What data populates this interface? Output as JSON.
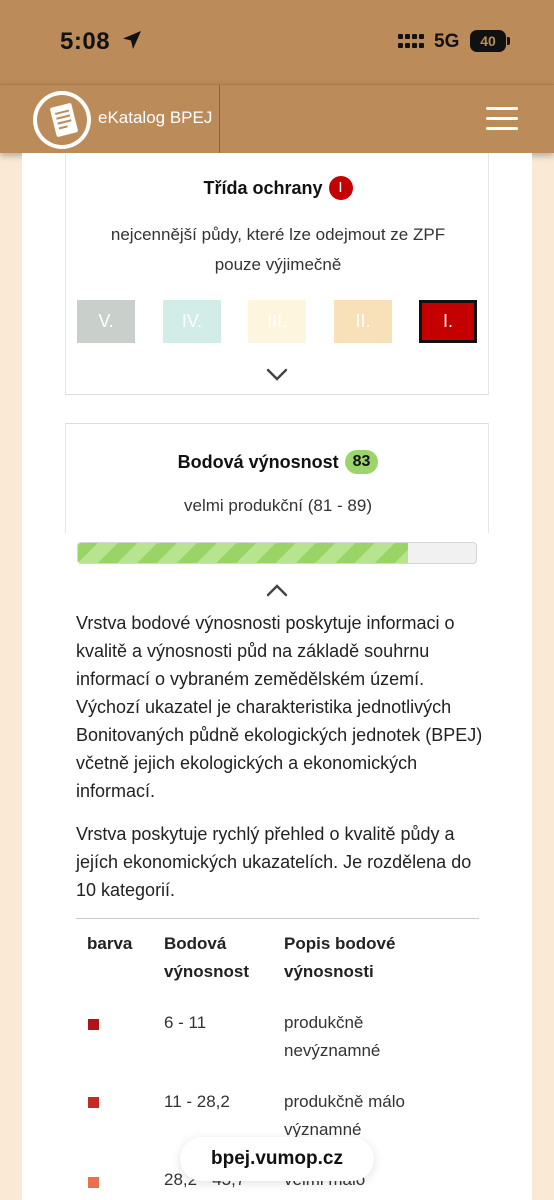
{
  "status_bar": {
    "time": "5:08",
    "network": "5G",
    "battery": "40"
  },
  "header": {
    "app_title": "eKatalog BPEJ"
  },
  "protection_card": {
    "title": "Třída ochrany",
    "badge": "I",
    "description_line1": "nejcennější půdy, které lze odejmout ze ZPF",
    "description_line2": "pouze výjimečně",
    "classes": [
      {
        "label": "V.",
        "color": "#c9d0cb",
        "active": false
      },
      {
        "label": "IV.",
        "color": "#d2ece8",
        "active": false
      },
      {
        "label": "III.",
        "color": "#fdf5dd",
        "active": false
      },
      {
        "label": "II.",
        "color": "#f8e0b9",
        "active": false
      },
      {
        "label": "I.",
        "color": "#c40000",
        "active": true
      }
    ]
  },
  "yield_card": {
    "title": "Bodová výnosnost",
    "badge": "83",
    "description": "velmi produkční (81 - 89)",
    "progress_fraction": 0.83,
    "paragraph1": "Vrstva bodové výnosnosti poskytuje informaci o kvalitě a výnosnosti půd na základě souhrnu informací o vybraném zemědělském území. Výchozí ukazatel je charakteristika jednotlivých Bonitovaných půdně ekologických jednotek (BPEJ) včetně jejich ekologických a ekonomických informací.",
    "paragraph2": "Vrstva poskytuje rychlý přehled o kvalitě půdy a jejích ekonomických ukazatelích. Je rozdělena do 10 kategorií."
  },
  "table": {
    "headers": {
      "color": "barva",
      "points": "Bodová výnosnost",
      "description": "Popis bodové výnosnosti"
    },
    "rows": [
      {
        "color": "#b3121a",
        "points": "6 - 11",
        "description": "produkčně nevýznamné"
      },
      {
        "color": "#c52a22",
        "points": "11 - 28,2",
        "description": "produkčně málo významné"
      },
      {
        "color": "#e9704f",
        "points": "28,2 - 43,7",
        "description": "velmi málo"
      }
    ]
  },
  "browser": {
    "url": "bpej.vumop.cz"
  }
}
